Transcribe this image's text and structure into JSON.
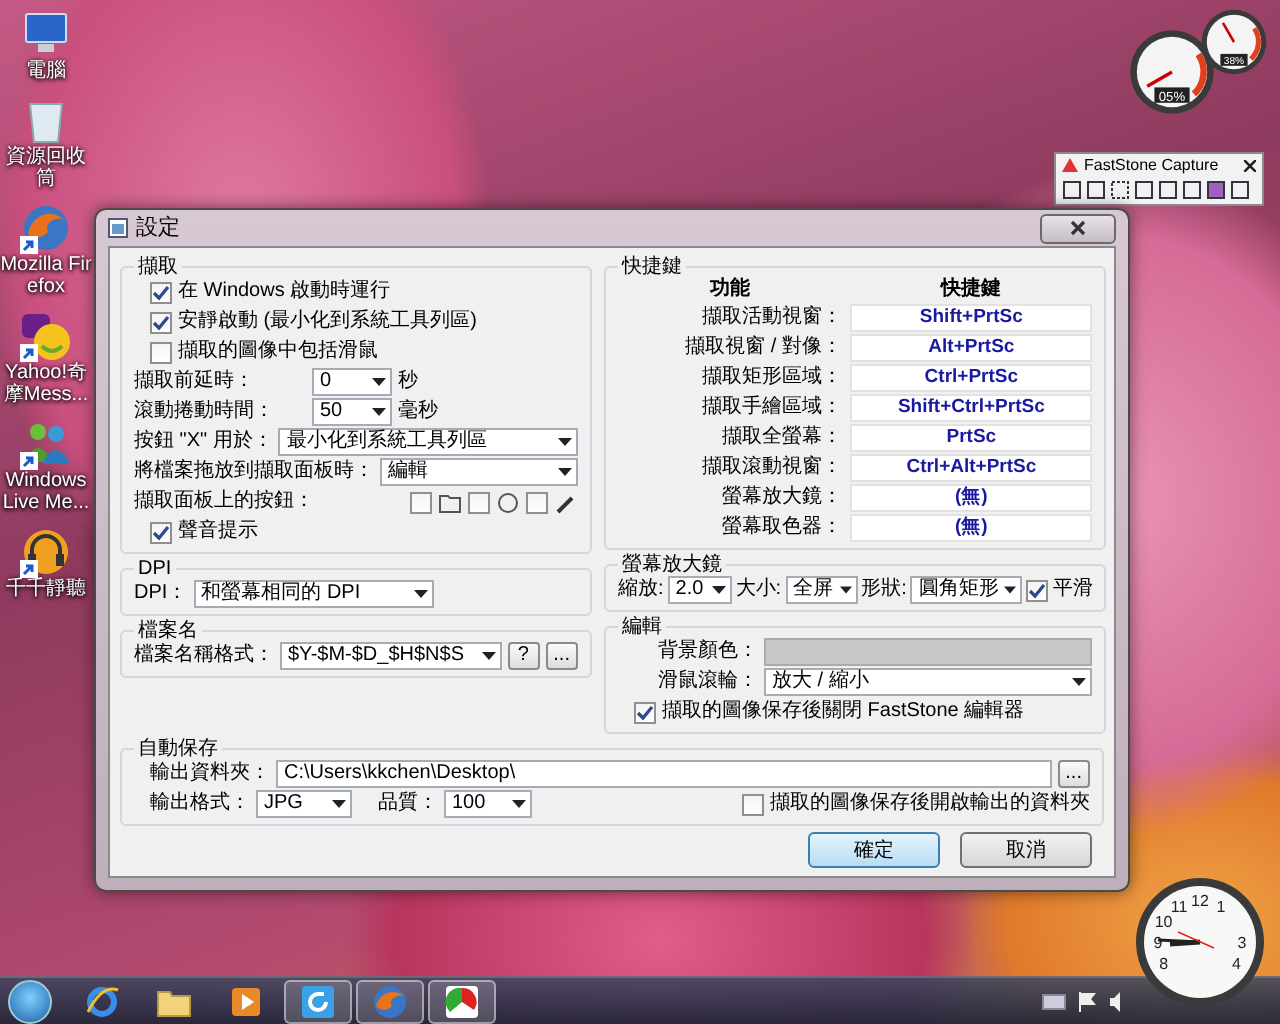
{
  "desktop_icons": [
    {
      "label": "電腦",
      "kind": "computer",
      "shortcut": false
    },
    {
      "label": "資源回收筒",
      "kind": "recycle-bin",
      "shortcut": false
    },
    {
      "label": "Mozilla Firefox",
      "kind": "firefox",
      "shortcut": true
    },
    {
      "label": "Yahoo!奇摩Mess...",
      "kind": "messenger",
      "shortcut": true
    },
    {
      "label": "Windows Live Me...",
      "kind": "live-messenger",
      "shortcut": true
    },
    {
      "label": "千千靜聽",
      "kind": "music",
      "shortcut": true
    }
  ],
  "gauges": [
    {
      "reading": "05%"
    },
    {
      "reading": "38%"
    }
  ],
  "capture_toolbar": {
    "title": "FastStone Capture"
  },
  "dialog": {
    "title": "設定",
    "capture": {
      "title": "擷取",
      "rows": [
        {
          "kind": "checkbox",
          "label": "在 Windows 啟動時運行",
          "checked": true
        },
        {
          "kind": "checkbox",
          "label": "安靜啟動 (最小化到系統工具列區)",
          "checked": true
        },
        {
          "kind": "checkbox",
          "label": "擷取的圖像中包括滑鼠",
          "checked": false
        },
        {
          "kind": "select",
          "label": "擷取前延時：",
          "value": "0",
          "unit": "秒"
        },
        {
          "kind": "select",
          "label": "滾動捲動時間：",
          "value": "50",
          "unit": "毫秒"
        },
        {
          "kind": "select",
          "label": "按鈕 \"X\" 用於：",
          "value": "最小化到系統工具列區"
        },
        {
          "kind": "select",
          "label": "將檔案拖放到擷取面板時：",
          "value": "編輯"
        },
        {
          "kind": "toggles",
          "label": "擷取面板上的按鈕：",
          "toggles": [
            {
              "checked": false
            },
            {
              "checked": false
            },
            {
              "checked": false
            }
          ]
        },
        {
          "kind": "checkbox",
          "label": "聲音提示",
          "checked": true
        }
      ]
    },
    "dpi": {
      "title": "DPI",
      "label": "DPI：",
      "value": "和螢幕相同的 DPI"
    },
    "filename": {
      "title": "檔案名",
      "label": "檔案名稱格式：",
      "value": "$Y-$M-$D_$H$N$S",
      "help": "?",
      "browse": "..."
    },
    "hotkeys": {
      "title": "快捷鍵",
      "headers": [
        "功能",
        "快捷鍵"
      ],
      "rows": [
        {
          "action": "擷取活動視窗：",
          "keys": "Shift+PrtSc"
        },
        {
          "action": "擷取視窗 / 對像：",
          "keys": "Alt+PrtSc"
        },
        {
          "action": "擷取矩形區域：",
          "keys": "Ctrl+PrtSc"
        },
        {
          "action": "擷取手繪區域：",
          "keys": "Shift+Ctrl+PrtSc"
        },
        {
          "action": "擷取全螢幕：",
          "keys": "PrtSc"
        },
        {
          "action": "擷取滾動視窗：",
          "keys": "Ctrl+Alt+PrtSc"
        },
        {
          "action": "螢幕放大鏡：",
          "keys": "(無)"
        },
        {
          "action": "螢幕取色器：",
          "keys": "(無)"
        }
      ]
    },
    "magnifier": {
      "title": "螢幕放大鏡",
      "zoom_label": "縮放:",
      "zoom": "2.0",
      "size_label": "大小:",
      "size": "全屏",
      "shape_label": "形狀:",
      "shape": "圓角矩形",
      "smooth": {
        "label": "平滑",
        "checked": true
      }
    },
    "editor": {
      "title": "編輯",
      "bg_label": "背景顏色：",
      "wheel_label": "滑鼠滾輪：",
      "wheel": "放大 / 縮小",
      "close_editor": {
        "label": "擷取的圖像保存後關閉 FastStone 編輯器",
        "checked": true
      }
    },
    "autosave": {
      "title": "自動保存",
      "folder_label": "輸出資料夾：",
      "folder": "C:\\Users\\kkchen\\Desktop\\",
      "browse": "...",
      "format_label": "輸出格式：",
      "format": "JPG",
      "quality_label": "品質：",
      "quality": "100",
      "open_folder": {
        "label": "擷取的圖像保存後開啟輸出的資料夾",
        "checked": false
      }
    },
    "buttons": [
      {
        "label": "確定",
        "default": true
      },
      {
        "label": "取消",
        "default": false
      }
    ]
  },
  "taskbar": {
    "items": [
      {
        "kind": "ie",
        "running": false
      },
      {
        "kind": "folder",
        "running": false
      },
      {
        "kind": "media",
        "running": false
      },
      {
        "kind": "capture",
        "running": true
      },
      {
        "kind": "firefox",
        "running": true
      },
      {
        "kind": "app",
        "running": true
      }
    ]
  },
  "clock": {
    "numerals": [
      "11",
      "12",
      "1",
      "10",
      "9",
      "3",
      "8",
      "4"
    ]
  }
}
